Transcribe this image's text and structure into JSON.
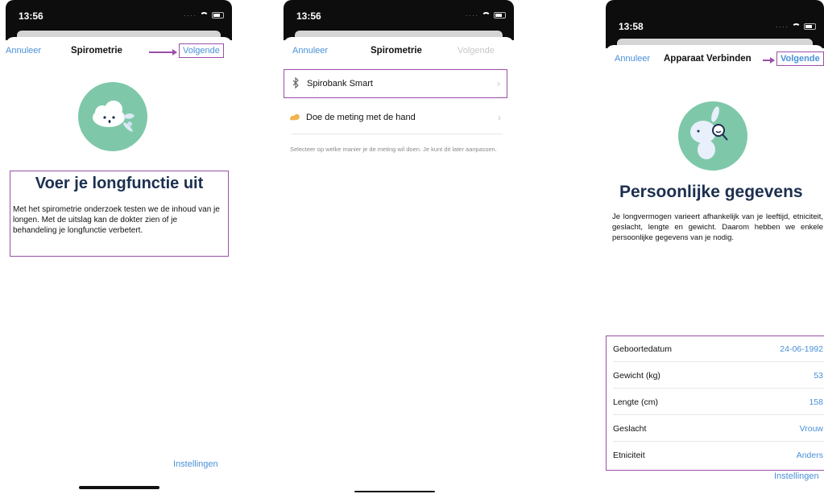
{
  "screens": [
    {
      "status_time": "13:56",
      "nav": {
        "left": "Annuleer",
        "title": "Spirometrie",
        "right": "Volgende"
      },
      "heading": "Voer je longfunctie uit",
      "body": "Met het spirometrie onderzoek testen we de inhoud van je longen. Met de uitslag kan de dokter zien of je behandeling je longfunctie verbetert.",
      "footer_link": "Instellingen"
    },
    {
      "status_time": "13:56",
      "nav": {
        "left": "Annuleer",
        "title": "Spirometrie",
        "right": "Volgende"
      },
      "options": [
        {
          "label": "Spirobank Smart",
          "icon": "bluetooth-icon"
        },
        {
          "label": "Doe de meting met de hand",
          "icon": "arm-icon"
        }
      ],
      "hint": "Selecteer op welke manier je de meting wil doen. Je kunt dit later aanpassen."
    },
    {
      "status_time": "13:58",
      "nav": {
        "left": "Annuleer",
        "title": "Apparaat Verbinden",
        "right": "Volgende"
      },
      "heading": "Persoonlijke gegevens",
      "body": "Je longvermogen varieert afhankelijk van je leeftijd, etniciteit, geslacht, lengte en gewicht. Daarom hebben we enkele persoonlijke gegevens van je nodig.",
      "fields": [
        {
          "label": "Geboortedatum",
          "value": "24-06-1992"
        },
        {
          "label": "Gewicht (kg)",
          "value": "53"
        },
        {
          "label": "Lengte (cm)",
          "value": "158"
        },
        {
          "label": "Geslacht",
          "value": "Vrouw"
        },
        {
          "label": "Etniciteit",
          "value": "Anders"
        }
      ],
      "footer_link": "Instellingen"
    }
  ],
  "colors": {
    "accent": "#4a90d9",
    "highlight": "#9b4fa8",
    "illustration": "#7ec8a9",
    "heading": "#1b2f4f"
  }
}
